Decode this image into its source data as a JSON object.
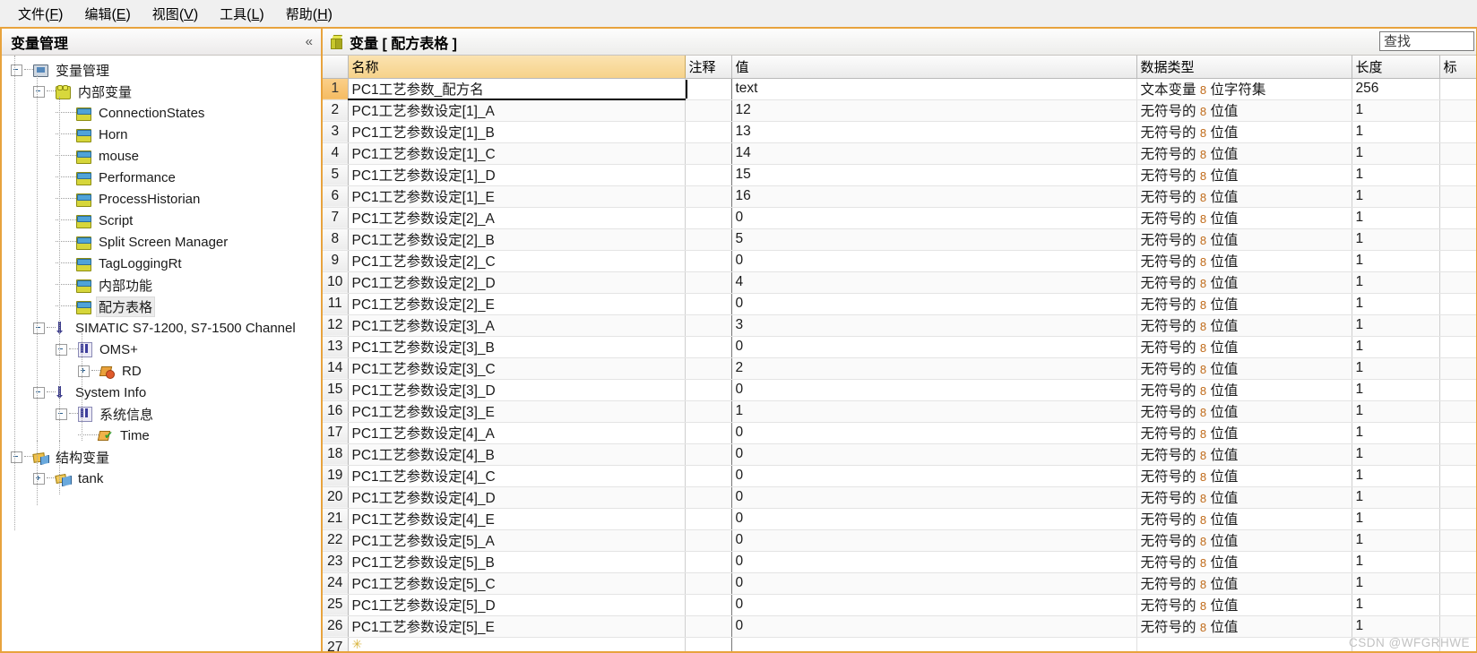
{
  "menubar": {
    "items": [
      {
        "label": "文件",
        "accel": "F"
      },
      {
        "label": "编辑",
        "accel": "E"
      },
      {
        "label": "视图",
        "accel": "V"
      },
      {
        "label": "工具",
        "accel": "L"
      },
      {
        "label": "帮助",
        "accel": "H"
      }
    ]
  },
  "sidebar": {
    "title": "变量管理",
    "collapse_glyph": "«",
    "tree": [
      {
        "label": "变量管理",
        "depth": 0,
        "icon": "monitor-icon",
        "expander": "minus",
        "selected": false
      },
      {
        "label": "内部变量",
        "depth": 1,
        "icon": "brick-icon",
        "expander": "minus",
        "selected": false
      },
      {
        "label": "ConnectionStates",
        "depth": 2,
        "icon": "tag-icon",
        "expander": "none",
        "selected": false
      },
      {
        "label": "Horn",
        "depth": 2,
        "icon": "tag-icon",
        "expander": "none",
        "selected": false
      },
      {
        "label": "mouse",
        "depth": 2,
        "icon": "tag-icon",
        "expander": "none",
        "selected": false
      },
      {
        "label": "Performance",
        "depth": 2,
        "icon": "tag-icon",
        "expander": "none",
        "selected": false
      },
      {
        "label": "ProcessHistorian",
        "depth": 2,
        "icon": "tag-icon",
        "expander": "none",
        "selected": false
      },
      {
        "label": "Script",
        "depth": 2,
        "icon": "tag-icon",
        "expander": "none",
        "selected": false
      },
      {
        "label": "Split Screen Manager",
        "depth": 2,
        "icon": "tag-icon",
        "expander": "none",
        "selected": false
      },
      {
        "label": "TagLoggingRt",
        "depth": 2,
        "icon": "tag-icon",
        "expander": "none",
        "selected": false
      },
      {
        "label": "内部功能",
        "depth": 2,
        "icon": "tag-icon",
        "expander": "none",
        "selected": false
      },
      {
        "label": "配方表格",
        "depth": 2,
        "icon": "tag-icon",
        "expander": "none",
        "selected": true
      },
      {
        "label": "SIMATIC S7-1200, S7-1500 Channel",
        "depth": 1,
        "icon": "channel-icon",
        "expander": "minus",
        "selected": false
      },
      {
        "label": "OMS+",
        "depth": 2,
        "icon": "connection-icon",
        "expander": "minus",
        "selected": false
      },
      {
        "label": "RD",
        "depth": 3,
        "icon": "rd-icon",
        "expander": "plus",
        "selected": false
      },
      {
        "label": "System Info",
        "depth": 1,
        "icon": "channel-icon",
        "expander": "minus",
        "selected": false
      },
      {
        "label": "系统信息",
        "depth": 2,
        "icon": "connection-icon",
        "expander": "minus",
        "selected": false
      },
      {
        "label": "Time",
        "depth": 3,
        "icon": "time-icon",
        "expander": "none",
        "selected": false
      },
      {
        "label": "结构变量",
        "depth": 0,
        "icon": "struct-icon",
        "expander": "minus",
        "selected": false
      },
      {
        "label": "tank",
        "depth": 1,
        "icon": "tank-icon",
        "expander": "plus",
        "selected": false
      }
    ]
  },
  "main": {
    "title": "变量  [  配方表格  ]",
    "icon": "cube-icon",
    "search": {
      "placeholder": "查找",
      "value": ""
    },
    "columns": [
      {
        "key": "rownum",
        "label": ""
      },
      {
        "key": "name",
        "label": "名称"
      },
      {
        "key": "comment",
        "label": "注释"
      },
      {
        "key": "value",
        "label": "值"
      },
      {
        "key": "type",
        "label": "数据类型"
      },
      {
        "key": "length",
        "label": "长度"
      },
      {
        "key": "extra",
        "label": "标"
      }
    ],
    "rows": [
      {
        "n": "1",
        "name": "PC1工艺参数_配方名",
        "comment": "",
        "value": "text",
        "type": "文本变量 8 位字符集",
        "length": "256",
        "selected": true
      },
      {
        "n": "2",
        "name": "PC1工艺参数设定[1]_A",
        "comment": "",
        "value": "12",
        "type": "无符号的 8 位值",
        "length": "1",
        "selected": false
      },
      {
        "n": "3",
        "name": "PC1工艺参数设定[1]_B",
        "comment": "",
        "value": "13",
        "type": "无符号的 8 位值",
        "length": "1",
        "selected": false
      },
      {
        "n": "4",
        "name": "PC1工艺参数设定[1]_C",
        "comment": "",
        "value": "14",
        "type": "无符号的 8 位值",
        "length": "1",
        "selected": false
      },
      {
        "n": "5",
        "name": "PC1工艺参数设定[1]_D",
        "comment": "",
        "value": "15",
        "type": "无符号的 8 位值",
        "length": "1",
        "selected": false
      },
      {
        "n": "6",
        "name": "PC1工艺参数设定[1]_E",
        "comment": "",
        "value": "16",
        "type": "无符号的 8 位值",
        "length": "1",
        "selected": false
      },
      {
        "n": "7",
        "name": "PC1工艺参数设定[2]_A",
        "comment": "",
        "value": "0",
        "type": "无符号的 8 位值",
        "length": "1",
        "selected": false
      },
      {
        "n": "8",
        "name": "PC1工艺参数设定[2]_B",
        "comment": "",
        "value": "5",
        "type": "无符号的 8 位值",
        "length": "1",
        "selected": false
      },
      {
        "n": "9",
        "name": "PC1工艺参数设定[2]_C",
        "comment": "",
        "value": "0",
        "type": "无符号的 8 位值",
        "length": "1",
        "selected": false
      },
      {
        "n": "10",
        "name": "PC1工艺参数设定[2]_D",
        "comment": "",
        "value": "4",
        "type": "无符号的 8 位值",
        "length": "1",
        "selected": false
      },
      {
        "n": "11",
        "name": "PC1工艺参数设定[2]_E",
        "comment": "",
        "value": "0",
        "type": "无符号的 8 位值",
        "length": "1",
        "selected": false
      },
      {
        "n": "12",
        "name": "PC1工艺参数设定[3]_A",
        "comment": "",
        "value": "3",
        "type": "无符号的 8 位值",
        "length": "1",
        "selected": false
      },
      {
        "n": "13",
        "name": "PC1工艺参数设定[3]_B",
        "comment": "",
        "value": "0",
        "type": "无符号的 8 位值",
        "length": "1",
        "selected": false
      },
      {
        "n": "14",
        "name": "PC1工艺参数设定[3]_C",
        "comment": "",
        "value": "2",
        "type": "无符号的 8 位值",
        "length": "1",
        "selected": false
      },
      {
        "n": "15",
        "name": "PC1工艺参数设定[3]_D",
        "comment": "",
        "value": "0",
        "type": "无符号的 8 位值",
        "length": "1",
        "selected": false
      },
      {
        "n": "16",
        "name": "PC1工艺参数设定[3]_E",
        "comment": "",
        "value": "1",
        "type": "无符号的 8 位值",
        "length": "1",
        "selected": false
      },
      {
        "n": "17",
        "name": "PC1工艺参数设定[4]_A",
        "comment": "",
        "value": "0",
        "type": "无符号的 8 位值",
        "length": "1",
        "selected": false
      },
      {
        "n": "18",
        "name": "PC1工艺参数设定[4]_B",
        "comment": "",
        "value": "0",
        "type": "无符号的 8 位值",
        "length": "1",
        "selected": false
      },
      {
        "n": "19",
        "name": "PC1工艺参数设定[4]_C",
        "comment": "",
        "value": "0",
        "type": "无符号的 8 位值",
        "length": "1",
        "selected": false
      },
      {
        "n": "20",
        "name": "PC1工艺参数设定[4]_D",
        "comment": "",
        "value": "0",
        "type": "无符号的 8 位值",
        "length": "1",
        "selected": false
      },
      {
        "n": "21",
        "name": "PC1工艺参数设定[4]_E",
        "comment": "",
        "value": "0",
        "type": "无符号的 8 位值",
        "length": "1",
        "selected": false
      },
      {
        "n": "22",
        "name": "PC1工艺参数设定[5]_A",
        "comment": "",
        "value": "0",
        "type": "无符号的 8 位值",
        "length": "1",
        "selected": false
      },
      {
        "n": "23",
        "name": "PC1工艺参数设定[5]_B",
        "comment": "",
        "value": "0",
        "type": "无符号的 8 位值",
        "length": "1",
        "selected": false
      },
      {
        "n": "24",
        "name": "PC1工艺参数设定[5]_C",
        "comment": "",
        "value": "0",
        "type": "无符号的 8 位值",
        "length": "1",
        "selected": false
      },
      {
        "n": "25",
        "name": "PC1工艺参数设定[5]_D",
        "comment": "",
        "value": "0",
        "type": "无符号的 8 位值",
        "length": "1",
        "selected": false
      },
      {
        "n": "26",
        "name": "PC1工艺参数设定[5]_E",
        "comment": "",
        "value": "0",
        "type": "无符号的 8 位值",
        "length": "1",
        "selected": false
      },
      {
        "n": "27",
        "name": "",
        "comment": "",
        "value": "",
        "type": "",
        "length": "",
        "selected": false,
        "newrow": true
      }
    ]
  },
  "watermark": "CSDN @WFGRHWE",
  "colors": {
    "accent_border": "#e8a33d",
    "name_header": "#f6d28a",
    "selected_row": "#f5bb62"
  }
}
